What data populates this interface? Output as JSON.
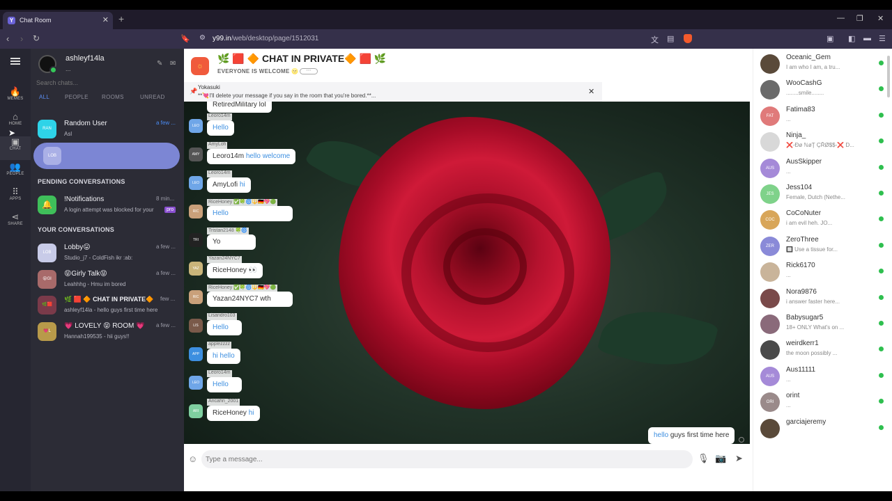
{
  "browser": {
    "tab_title": "Chat Room",
    "new_tab": "+",
    "tab_close": "✕",
    "url_host": "y99.in",
    "url_path": "/web/desktop/page/1512031"
  },
  "rail": {
    "items": [
      {
        "label": "MEMES",
        "icon": "flame-icon",
        "glyph": "🔥"
      },
      {
        "label": "HOME",
        "icon": "home-icon",
        "glyph": "⌂"
      },
      {
        "label": "CHAT",
        "icon": "chat-icon",
        "glyph": "▣"
      },
      {
        "label": "PEOPLE",
        "icon": "people-icon",
        "glyph": "👥"
      },
      {
        "label": "APPS",
        "icon": "apps-icon",
        "glyph": "⠿"
      },
      {
        "label": "SHARE",
        "icon": "share-icon",
        "glyph": "⋖"
      }
    ]
  },
  "sidebar": {
    "username": "ashleyf14la",
    "user_status": "...",
    "search_placeholder": "Search chats...",
    "filters": [
      "ALL",
      "PEOPLE",
      "ROOMS",
      "UNREAD"
    ],
    "top_conversation": {
      "avatar": "RAN",
      "name": "Random User",
      "message": "Asl",
      "time": "a few ..."
    },
    "selected_avatar": "LOB",
    "pending_title": "PENDING CONVERSATIONS",
    "pending": {
      "name": "!Notifications",
      "message": "A login attempt was blocked for your",
      "time": "8 min...",
      "badge": "pro"
    },
    "your_title": "YOUR CONVERSATIONS",
    "conversations": [
      {
        "avatar": "LOB",
        "name": "Lobby😛",
        "message": "Studio_j7 - ColdFish ikr :ab:",
        "time": "a few ..."
      },
      {
        "avatar": "😝GI",
        "name": "😝Girly Talk😝",
        "message": "Leahhhg - Hmu im bored",
        "time": "a few ..."
      },
      {
        "avatar": "🌿🟥",
        "name": "🌿 🟥 🔶 CHAT IN PRIVATE🔶",
        "message": "ashleyf14la - hello guys first time here",
        "time": "few ..."
      },
      {
        "avatar": "💗L",
        "name": "💗 LOVELY 😝 ROOM 💗",
        "message": "Hannah199535 - hii guys!!",
        "time": "a few ..."
      }
    ]
  },
  "room": {
    "title": "🌿 🟥 🔶 CHAT IN PRIVATE🔶 🟥 🌿",
    "subtitle": "EVERYONE IS WELCOME 🌝",
    "more": "⋯",
    "pinned_user": "Yokasuki",
    "pinned_text": "**💘I'll delete your message if you say in the room that you're bored.**...",
    "message_placeholder": "Type a message...",
    "my_message_prefix": "hello",
    "my_message_rest": " guys first time here",
    "messages": [
      {
        "user": "",
        "avatar": "",
        "pre": "RetiredMilitary lol",
        "hl": ""
      },
      {
        "user": "Leoro14m",
        "avatar": "LEO",
        "pre": "",
        "hl": "Hello"
      },
      {
        "user": "AmyLofi",
        "avatar": "AMY",
        "pre": "Leoro14m ",
        "hl": "hello welcome"
      },
      {
        "user": "Leoro14m",
        "avatar": "LEO",
        "pre": "AmyLofi ",
        "hl": "hi"
      },
      {
        "user": "RiceHoney ✅🍀🌀🔱🇩🇪💖🟢",
        "avatar": "RIC",
        "pre": "",
        "hl": "Hello"
      },
      {
        "user": "Tristan2148 🍀🌀",
        "avatar": "TRI",
        "pre": "Yo",
        "hl": ""
      },
      {
        "user": "Yazan24NYC7",
        "avatar": "YAZ",
        "pre": "RiceHoney 👀",
        "hl": ""
      },
      {
        "user": "RiceHoney ✅🍀🌀🔱🇩🇪💖🟢",
        "avatar": "RIC",
        "pre": "Yazan24NYC7 wth",
        "hl": ""
      },
      {
        "user": "Lisandro103",
        "avatar": "LIS",
        "pre": "",
        "hl": "Hello"
      },
      {
        "user": "applezzzz",
        "avatar": "APP",
        "pre": "",
        "hl": "hi hello"
      },
      {
        "user": "Leoro14m",
        "avatar": "LEO",
        "pre": "",
        "hl": "Hello"
      },
      {
        "user": "Aricahn_2001",
        "avatar": "ARI",
        "pre": "RiceHoney ",
        "hl": "hi"
      }
    ]
  },
  "users": [
    {
      "name": "Oceanic_Gem",
      "status": "I am who I am, a tru...",
      "avatar": "",
      "color": "#5a4a3a"
    },
    {
      "name": "WooCashG",
      "status": "........smile........",
      "avatar": "",
      "color": "#6a6a6a"
    },
    {
      "name": "Fatima83",
      "status": "...",
      "avatar": "FAT",
      "color": "#e07a7a"
    },
    {
      "name": "Ninja_",
      "status": "❌-Ðø ℕøŢ ÇŘØ$$-❌ D...",
      "avatar": "",
      "color": "#d8d8d8"
    },
    {
      "name": "AusSkipper",
      "status": "...",
      "avatar": "AUS",
      "color": "#a58ad8"
    },
    {
      "name": "Jess104",
      "status": "Female, Dutch (Nethe...",
      "avatar": "JES",
      "color": "#7fd28a"
    },
    {
      "name": "CoCoNuter",
      "status": "i am evil heh. JO...",
      "avatar": "COC",
      "color": "#d8a65a"
    },
    {
      "name": "ZeroThree",
      "status": "🔲 Use a tissue for...",
      "avatar": "ZER",
      "color": "#8a8ad8"
    },
    {
      "name": "Rick6170",
      "status": "...",
      "avatar": "",
      "color": "#c9b49a"
    },
    {
      "name": "Nora9876",
      "status": "i answer faster here...",
      "avatar": "",
      "color": "#7a4a4a"
    },
    {
      "name": "Babysugar5",
      "status": "18+ ONLY What's on ...",
      "avatar": "",
      "color": "#8a6a7a"
    },
    {
      "name": "weirdkerr1",
      "status": "the moon possibly ...",
      "avatar": "",
      "color": "#4a4a4a"
    },
    {
      "name": "Aus11111",
      "status": "...",
      "avatar": "AUS",
      "color": "#a58ad8"
    },
    {
      "name": "orint",
      "status": "...",
      "avatar": "ORI",
      "color": "#9a8a8a"
    },
    {
      "name": "garciajeremy",
      "status": "",
      "avatar": "",
      "color": "#5a4a3a"
    }
  ],
  "colors": {
    "accent": "#4a8cf5",
    "online": "#2fbf4f",
    "sidebar_bg": "#2c2c36",
    "selected_pill": "#7c86d4"
  }
}
